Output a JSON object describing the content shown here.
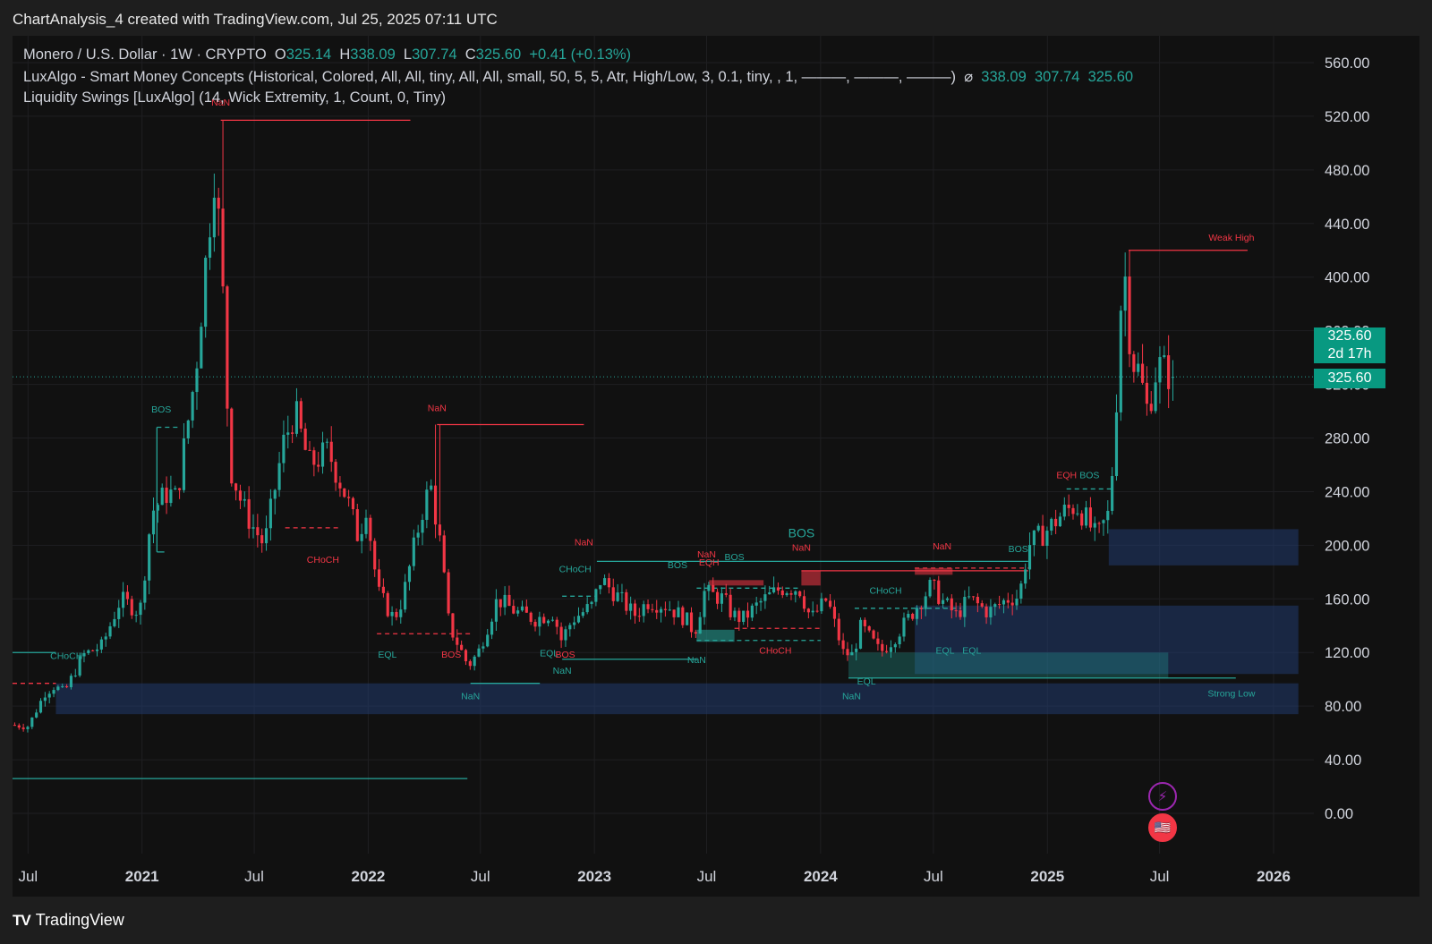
{
  "header": {
    "title": "ChartAnalysis_4 created with TradingView.com, Jul 25, 2025 07:11 UTC"
  },
  "legend": {
    "symbol": "Monero / U.S. Dollar · 1W · CRYPTO",
    "ohlc": {
      "o_label": "O",
      "o": "325.14",
      "h_label": "H",
      "h": "338.09",
      "l_label": "L",
      "l": "307.74",
      "c_label": "C",
      "c": "325.60",
      "change": "+0.41 (+0.13%)"
    },
    "indicator1": "LuxAlgo - Smart Money Concepts (Historical, Colored, All, All, tiny, All, All, small, 50, 5, 5, Atr, High/Low, 3, 0.1, tiny, , 1, ———, ———, ———)",
    "indicator1_symbol": "⌀",
    "indicator1_values": [
      "338.09",
      "307.74",
      "325.60"
    ],
    "indicator2": "Liquidity Swings [LuxAlgo] (14, Wick Extremity, 1, Count, 0, Tiny)"
  },
  "price_tags": {
    "price": "325.60",
    "countdown": "2d 17h",
    "price2": "325.60"
  },
  "footer": {
    "brand": "TradingView",
    "brand_mark": "TV"
  },
  "colors": {
    "up": "#26a69a",
    "down": "#f23645",
    "background": "#111111",
    "zone": "#1c2b4a"
  },
  "chart_data": {
    "type": "candlestick",
    "symbol": "XMR/USD",
    "timeframe": "1W",
    "ylim": [
      -30,
      580
    ],
    "y_ticks": [
      "560.00",
      "520.00",
      "480.00",
      "440.00",
      "400.00",
      "360.00",
      "320.00",
      "280.00",
      "240.00",
      "200.00",
      "160.00",
      "120.00",
      "80.00",
      "40.00",
      "0.00"
    ],
    "x_ticks": [
      {
        "label": "Jul",
        "date": "2020-07-01",
        "major": false
      },
      {
        "label": "2021",
        "date": "2021-01-01",
        "major": true
      },
      {
        "label": "Jul",
        "date": "2021-07-01",
        "major": false
      },
      {
        "label": "2022",
        "date": "2022-01-01",
        "major": true
      },
      {
        "label": "Jul",
        "date": "2022-07-01",
        "major": false
      },
      {
        "label": "2023",
        "date": "2023-01-01",
        "major": true
      },
      {
        "label": "Jul",
        "date": "2023-07-01",
        "major": false
      },
      {
        "label": "2024",
        "date": "2024-01-01",
        "major": true
      },
      {
        "label": "Jul",
        "date": "2024-07-01",
        "major": false
      },
      {
        "label": "2025",
        "date": "2025-01-01",
        "major": true
      },
      {
        "label": "Jul",
        "date": "2025-07-01",
        "major": false
      },
      {
        "label": "2026",
        "date": "2026-01-01",
        "major": true
      }
    ],
    "x_range": [
      "2020-06-06",
      "2026-03-07"
    ],
    "price_path": [
      [
        "2020-06-06",
        66
      ],
      [
        "2020-07-05",
        65
      ],
      [
        "2020-08-01",
        90
      ],
      [
        "2020-08-16",
        95
      ],
      [
        "2020-09-01",
        90
      ],
      [
        "2020-10-01",
        118
      ],
      [
        "2020-11-01",
        125
      ],
      [
        "2020-12-01",
        160
      ],
      [
        "2021-01-01",
        150
      ],
      [
        "2021-01-20",
        225
      ],
      [
        "2021-02-15",
        240
      ],
      [
        "2021-03-01",
        235
      ],
      [
        "2021-04-01",
        330
      ],
      [
        "2021-05-01",
        480
      ],
      [
        "2021-05-12",
        420
      ],
      [
        "2021-05-26",
        260
      ],
      [
        "2021-06-15",
        230
      ],
      [
        "2021-07-01",
        215
      ],
      [
        "2021-07-21",
        200
      ],
      [
        "2021-08-20",
        275
      ],
      [
        "2021-09-08",
        300
      ],
      [
        "2021-10-01",
        260
      ],
      [
        "2021-11-01",
        270
      ],
      [
        "2021-12-01",
        235
      ],
      [
        "2021-12-20",
        205
      ],
      [
        "2022-01-01",
        230
      ],
      [
        "2022-01-20",
        165
      ],
      [
        "2022-02-15",
        145
      ],
      [
        "2022-03-01",
        160
      ],
      [
        "2022-04-01",
        225
      ],
      [
        "2022-04-15",
        245
      ],
      [
        "2022-05-01",
        200
      ],
      [
        "2022-05-15",
        140
      ],
      [
        "2022-06-15",
        110
      ],
      [
        "2022-07-01",
        120
      ],
      [
        "2022-08-01",
        160
      ],
      [
        "2022-09-01",
        150
      ],
      [
        "2022-10-01",
        145
      ],
      [
        "2022-11-01",
        150
      ],
      [
        "2022-11-10",
        128
      ],
      [
        "2022-12-01",
        145
      ],
      [
        "2023-01-01",
        155
      ],
      [
        "2023-01-15",
        175
      ],
      [
        "2023-02-15",
        160
      ],
      [
        "2023-03-10",
        148
      ],
      [
        "2023-04-01",
        158
      ],
      [
        "2023-05-01",
        155
      ],
      [
        "2023-06-01",
        145
      ],
      [
        "2023-06-15",
        135
      ],
      [
        "2023-07-01",
        165
      ],
      [
        "2023-08-01",
        160
      ],
      [
        "2023-08-15",
        148
      ],
      [
        "2023-09-01",
        145
      ],
      [
        "2023-10-01",
        158
      ],
      [
        "2023-11-01",
        168
      ],
      [
        "2023-12-01",
        168
      ],
      [
        "2023-12-20",
        145
      ],
      [
        "2024-01-15",
        160
      ],
      [
        "2024-02-10",
        120
      ],
      [
        "2024-02-25",
        118
      ],
      [
        "2024-03-10",
        140
      ],
      [
        "2024-04-10",
        120
      ],
      [
        "2024-05-01",
        130
      ],
      [
        "2024-06-01",
        150
      ],
      [
        "2024-07-01",
        170
      ],
      [
        "2024-07-20",
        158
      ],
      [
        "2024-08-10",
        148
      ],
      [
        "2024-09-01",
        160
      ],
      [
        "2024-10-01",
        150
      ],
      [
        "2024-11-01",
        160
      ],
      [
        "2024-11-20",
        162
      ],
      [
        "2024-12-05",
        200
      ],
      [
        "2025-01-01",
        210
      ],
      [
        "2025-02-01",
        225
      ],
      [
        "2025-02-20",
        230
      ],
      [
        "2025-03-10",
        218
      ],
      [
        "2025-03-25",
        205
      ],
      [
        "2025-04-15",
        225
      ],
      [
        "2025-04-25",
        300
      ],
      [
        "2025-05-03",
        380
      ],
      [
        "2025-05-10",
        400
      ],
      [
        "2025-05-20",
        340
      ],
      [
        "2025-06-01",
        330
      ],
      [
        "2025-06-15",
        300
      ],
      [
        "2025-07-01",
        335
      ],
      [
        "2025-07-25",
        325.6
      ]
    ],
    "spikes": [
      {
        "date": "2021-05-08",
        "high": 517
      },
      {
        "date": "2022-04-22",
        "high": 290
      },
      {
        "date": "2025-05-10",
        "high": 420
      }
    ],
    "last": {
      "open": 325.14,
      "high": 338.09,
      "low": 307.74,
      "close": 325.6
    },
    "labels": [
      {
        "text": "NaN",
        "date": "2021-05-08",
        "y": 528,
        "color": "down"
      },
      {
        "text": "BOS",
        "date": "2021-02-01",
        "y": 299,
        "color": "up"
      },
      {
        "text": "CHoCH",
        "date": "2021-10-20",
        "y": 187,
        "color": "down"
      },
      {
        "text": "NaN",
        "date": "2022-04-22",
        "y": 300,
        "color": "down"
      },
      {
        "text": "CHoCH",
        "date": "2020-09-01",
        "y": 115,
        "color": "up"
      },
      {
        "text": "EQL",
        "date": "2022-02-01",
        "y": 116,
        "color": "up"
      },
      {
        "text": "BOS",
        "date": "2022-05-15",
        "y": 116,
        "color": "down"
      },
      {
        "text": "NaN",
        "date": "2022-06-15",
        "y": 85,
        "color": "up"
      },
      {
        "text": "CHoCH",
        "date": "2022-12-01",
        "y": 180,
        "color": "up"
      },
      {
        "text": "NaN",
        "date": "2022-12-15",
        "y": 200,
        "color": "down"
      },
      {
        "text": "EQL",
        "date": "2022-10-20",
        "y": 117,
        "color": "up"
      },
      {
        "text": "BOS",
        "date": "2022-11-15",
        "y": 116,
        "color": "down"
      },
      {
        "text": "NaN",
        "date": "2022-11-10",
        "y": 104,
        "color": "up"
      },
      {
        "text": "BOS",
        "date": "2023-05-15",
        "y": 183,
        "color": "up"
      },
      {
        "text": "NaN",
        "date": "2023-07-01",
        "y": 191,
        "color": "down"
      },
      {
        "text": "EQH",
        "date": "2023-07-05",
        "y": 185,
        "color": "down"
      },
      {
        "text": "BOS",
        "date": "2023-08-15",
        "y": 189,
        "color": "up"
      },
      {
        "text": "NaN",
        "date": "2023-06-15",
        "y": 112,
        "color": "up"
      },
      {
        "text": "BOS",
        "date": "2023-12-01",
        "y": 206,
        "color": "up"
      },
      {
        "text": "NaN",
        "date": "2023-12-01",
        "y": 196,
        "color": "down"
      },
      {
        "text": "CHoCH",
        "date": "2023-10-20",
        "y": 119,
        "color": "down"
      },
      {
        "text": "CHoCH",
        "date": "2024-04-15",
        "y": 164,
        "color": "up"
      },
      {
        "text": "NaN",
        "date": "2024-07-15",
        "y": 197,
        "color": "down"
      },
      {
        "text": "BOS",
        "date": "2024-11-15",
        "y": 195,
        "color": "up"
      },
      {
        "text": "EQL",
        "date": "2024-07-20",
        "y": 119,
        "color": "up"
      },
      {
        "text": "EQL",
        "date": "2024-09-01",
        "y": 119,
        "color": "up"
      },
      {
        "text": "EQL",
        "date": "2024-03-15",
        "y": 96,
        "color": "up"
      },
      {
        "text": "NaN",
        "date": "2024-02-20",
        "y": 85,
        "color": "up"
      },
      {
        "text": "EQH",
        "date": "2025-02-01",
        "y": 250,
        "color": "down"
      },
      {
        "text": "BOS",
        "date": "2025-03-10",
        "y": 250,
        "color": "up"
      },
      {
        "text": "Weak High",
        "date": "2025-10-25",
        "y": 427,
        "color": "down"
      },
      {
        "text": "Strong Low",
        "date": "2025-10-25",
        "y": 87,
        "color": "up"
      }
    ],
    "levels": [
      {
        "from": "2021-05-08",
        "to": "2022-03-10",
        "y": 517,
        "color": "down",
        "dash": false
      },
      {
        "from": "2022-04-22",
        "to": "2022-12-15",
        "y": 290,
        "color": "down",
        "dash": false
      },
      {
        "from": "2025-05-12",
        "to": "2025-11-20",
        "y": 420,
        "color": "down",
        "dash": false
      },
      {
        "from": "2021-01-25",
        "to": "2021-03-05",
        "y": 288,
        "color": "up",
        "dash": true
      },
      {
        "from": "2021-01-25",
        "to": "2021-02-06",
        "y": 195,
        "color": "up",
        "dash": false,
        "vertical_to": 288
      },
      {
        "from": "2020-06-06",
        "to": "2020-08-15",
        "y": 120,
        "color": "up",
        "dash": false
      },
      {
        "from": "2020-06-06",
        "to": "2020-08-15",
        "y": 97,
        "color": "down",
        "dash": true
      },
      {
        "from": "2020-06-06",
        "to": "2022-06-10",
        "y": 26,
        "color": "up",
        "dash": false
      },
      {
        "from": "2021-08-20",
        "to": "2021-11-15",
        "y": 213,
        "color": "down",
        "dash": true
      },
      {
        "from": "2022-01-15",
        "to": "2022-06-15",
        "y": 134,
        "color": "down",
        "dash": true
      },
      {
        "from": "2022-06-15",
        "to": "2022-10-05",
        "y": 97,
        "color": "up",
        "dash": false
      },
      {
        "from": "2023-01-05",
        "to": "2024-12-01",
        "y": 188,
        "color": "up",
        "dash": false
      },
      {
        "from": "2022-11-10",
        "to": "2023-06-15",
        "y": 115,
        "color": "up",
        "dash": false
      },
      {
        "from": "2022-11-10",
        "to": "2023-01-05",
        "y": 162,
        "color": "up",
        "dash": true
      },
      {
        "from": "2023-06-15",
        "to": "2023-12-01",
        "y": 168,
        "color": "up",
        "dash": true
      },
      {
        "from": "2023-06-15",
        "to": "2024-01-01",
        "y": 129,
        "color": "up",
        "dash": true
      },
      {
        "from": "2023-08-15",
        "to": "2024-01-01",
        "y": 138,
        "color": "down",
        "dash": true
      },
      {
        "from": "2023-12-01",
        "to": "2024-12-01",
        "y": 181,
        "color": "down",
        "dash": false
      },
      {
        "from": "2024-06-01",
        "to": "2024-12-01",
        "y": 183,
        "color": "down",
        "dash": true
      },
      {
        "from": "2024-02-15",
        "to": "2025-11-01",
        "y": 101,
        "color": "up",
        "dash": false
      },
      {
        "from": "2024-02-25",
        "to": "2024-08-15",
        "y": 153,
        "color": "up",
        "dash": true
      },
      {
        "from": "2025-02-01",
        "to": "2025-04-15",
        "y": 242,
        "color": "up",
        "dash": true
      }
    ],
    "zones": [
      {
        "from": "2020-08-15",
        "to": "2026-02-10",
        "y1": 74,
        "y2": 97,
        "kind": "blue"
      },
      {
        "from": "2025-04-10",
        "to": "2026-02-10",
        "y1": 185,
        "y2": 212,
        "kind": "blue"
      },
      {
        "from": "2024-06-01",
        "to": "2026-02-10",
        "y1": 104,
        "y2": 155,
        "kind": "blue"
      },
      {
        "from": "2024-02-15",
        "to": "2025-07-15",
        "y1": 101,
        "y2": 120,
        "kind": "teal"
      },
      {
        "from": "2023-06-15",
        "to": "2023-08-15",
        "y1": 128,
        "y2": 137,
        "kind": "tealsolid"
      },
      {
        "from": "2023-07-05",
        "to": "2023-10-01",
        "y1": 170,
        "y2": 174,
        "kind": "red"
      },
      {
        "from": "2023-12-01",
        "to": "2024-01-01",
        "y1": 170,
        "y2": 181,
        "kind": "red"
      },
      {
        "from": "2024-06-01",
        "to": "2024-08-01",
        "y1": 178,
        "y2": 183,
        "kind": "red"
      }
    ],
    "grid": true,
    "current_price_line": 325.6
  }
}
